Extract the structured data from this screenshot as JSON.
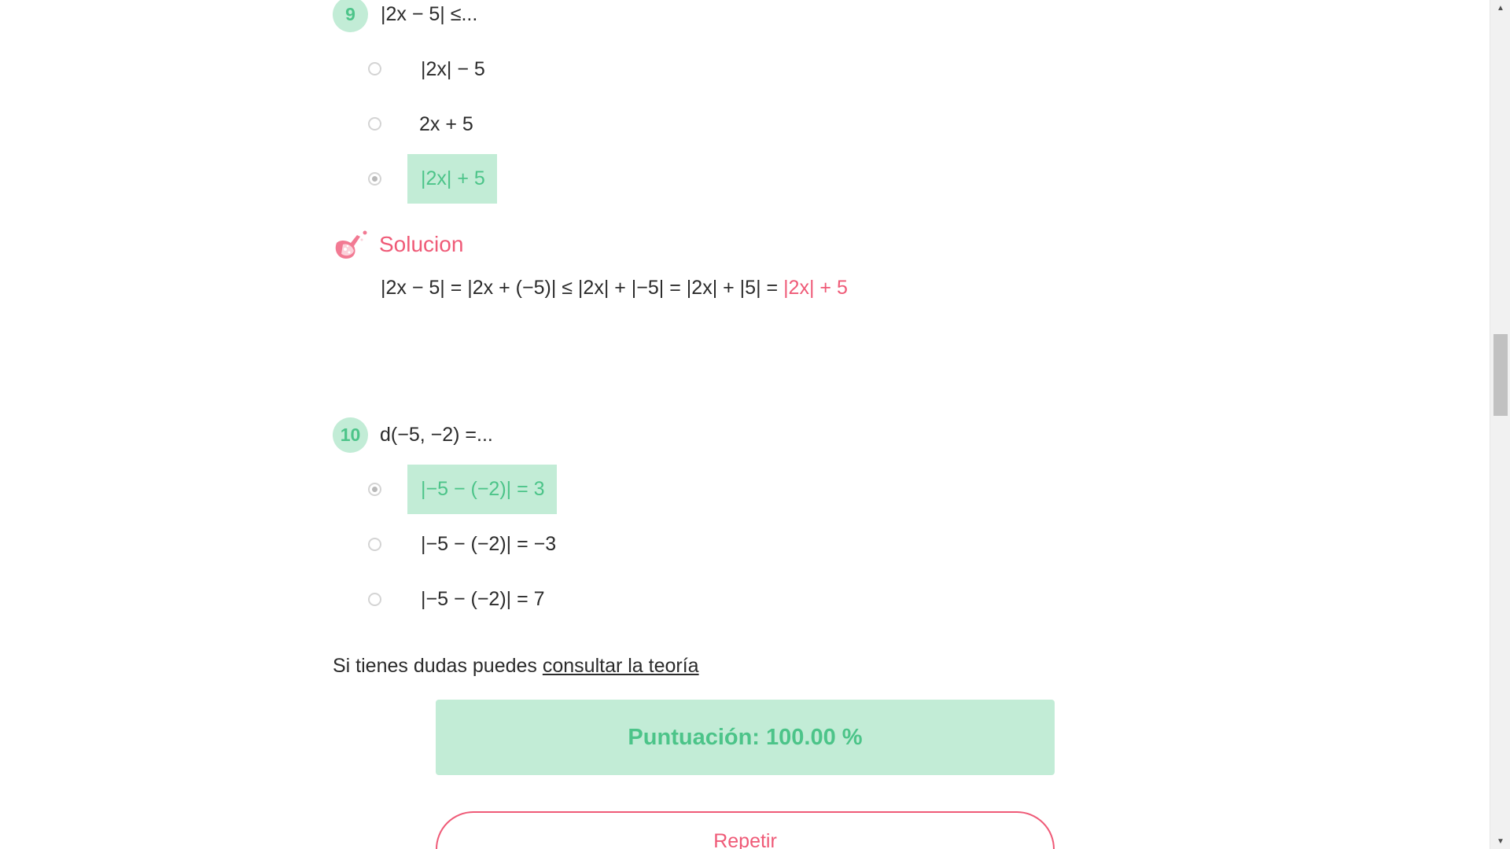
{
  "question9": {
    "number": "9",
    "text": "|2x − 5| ≤...",
    "options": [
      {
        "label": "|2x| − 5",
        "selected": false,
        "correct": false
      },
      {
        "label": "2x + 5",
        "selected": false,
        "correct": false
      },
      {
        "label": "|2x| + 5",
        "selected": true,
        "correct": true
      }
    ],
    "solution": {
      "title": "Solucion",
      "text": "|2x − 5| = |2x + (−5)| ≤ |2x| + |−5| = |2x| + |5| = ",
      "highlight": "|2x| + 5",
      "icon": "flask-icon"
    }
  },
  "question10": {
    "number": "10",
    "text": "d(−5, −2) =...",
    "options": [
      {
        "label": "|−5 − (−2)| = 3",
        "selected": true,
        "correct": true
      },
      {
        "label": "|−5 − (−2)| = −3",
        "selected": false,
        "correct": false
      },
      {
        "label": "|−5 − (−2)| = 7",
        "selected": false,
        "correct": false
      }
    ]
  },
  "help": {
    "prefix": "Si tienes dudas puedes ",
    "link": "consultar la teoría"
  },
  "score": {
    "label": "Puntuación: 100.00 %",
    "percent": 100
  },
  "repeat_button": "Repetir",
  "colors": {
    "accent_green": "#4cc489",
    "green_bg": "#c2ecd6",
    "accent_pink": "#ef5a77"
  }
}
